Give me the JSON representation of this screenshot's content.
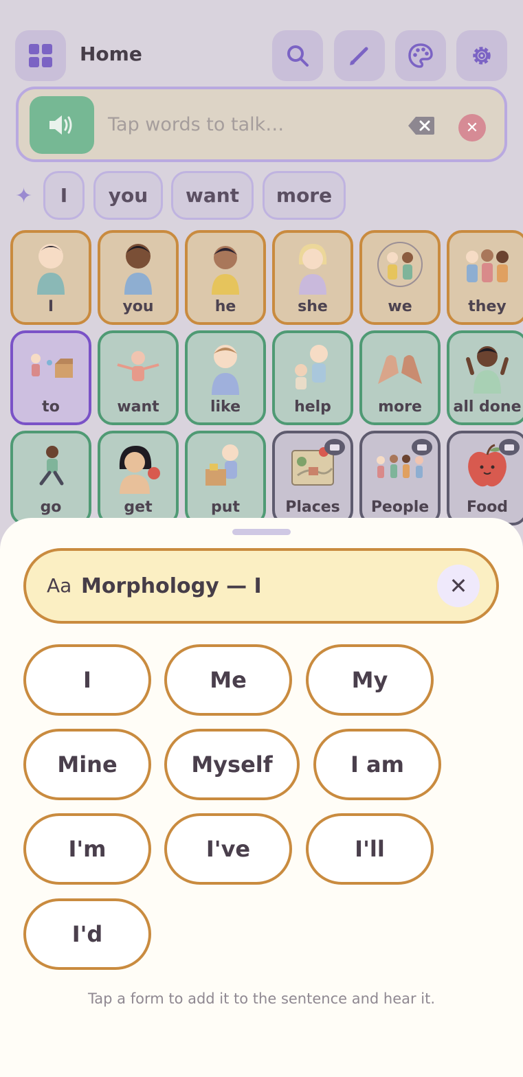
{
  "header": {
    "title": "Home",
    "icons": [
      "grid-icon",
      "search-icon",
      "pencil-icon",
      "palette-icon",
      "gear-icon"
    ]
  },
  "sentence_bar": {
    "placeholder": "Tap words to talk…",
    "icons": [
      "speaker-icon",
      "backspace-icon",
      "clear-icon"
    ]
  },
  "predictions": [
    "I",
    "you",
    "want",
    "more"
  ],
  "tiles": {
    "row1": [
      "I",
      "you",
      "he",
      "she",
      "we",
      "they"
    ],
    "row2": [
      "to",
      "want",
      "like",
      "help",
      "more",
      "all done"
    ],
    "row3": [
      "go",
      "get",
      "put",
      "Places",
      "People",
      "Food"
    ]
  },
  "morphology": {
    "prefix": "Aa",
    "title": "Morphology — I",
    "forms": [
      "I",
      "Me",
      "My",
      "Mine",
      "Myself",
      "I am",
      "I'm",
      "I've",
      "I'll",
      "I'd"
    ],
    "hint": "Tap a form to add it to the sentence and hear it."
  },
  "colors": {
    "pronoun_border": "#c98b3f",
    "verb_border": "#4f9a74",
    "preposition_border": "#7a52c7",
    "folder_border": "#5e5b6e",
    "accent": "#b9a9e0"
  }
}
